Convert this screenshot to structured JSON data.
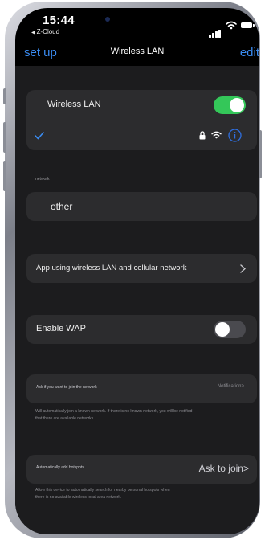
{
  "status": {
    "time": "15:44",
    "carrier": "Z-Cloud"
  },
  "nav": {
    "back_label": "set up",
    "title": "Wireless LAN",
    "edit_label": "edit"
  },
  "wlan": {
    "label": "Wireless LAN",
    "enabled": true
  },
  "section_network": "network",
  "other_label": "other",
  "apps_label": "App using wireless LAN and cellular network",
  "wap": {
    "label": "Enable WAP",
    "enabled": false
  },
  "ask_join": {
    "label": "Ask if you want to join the network",
    "value": "Notification>"
  },
  "ask_join_note": {
    "line1": "Will automatically join a known network. If there is no known network, you will be notified",
    "line2": "that there are available networks."
  },
  "hotspot": {
    "label": "Automatically add hotspots",
    "value": "Ask to join>"
  },
  "hotspot_note": {
    "line1": "Allow this device to automatically search for nearby personal hotspots when",
    "line2": "there is no available wireless local area network."
  },
  "colors": {
    "toggle_on": "#34c759",
    "toggle_off": "#4a4a4f",
    "accent": "#3a8bf0",
    "info_icon": "#2f6fe0"
  }
}
